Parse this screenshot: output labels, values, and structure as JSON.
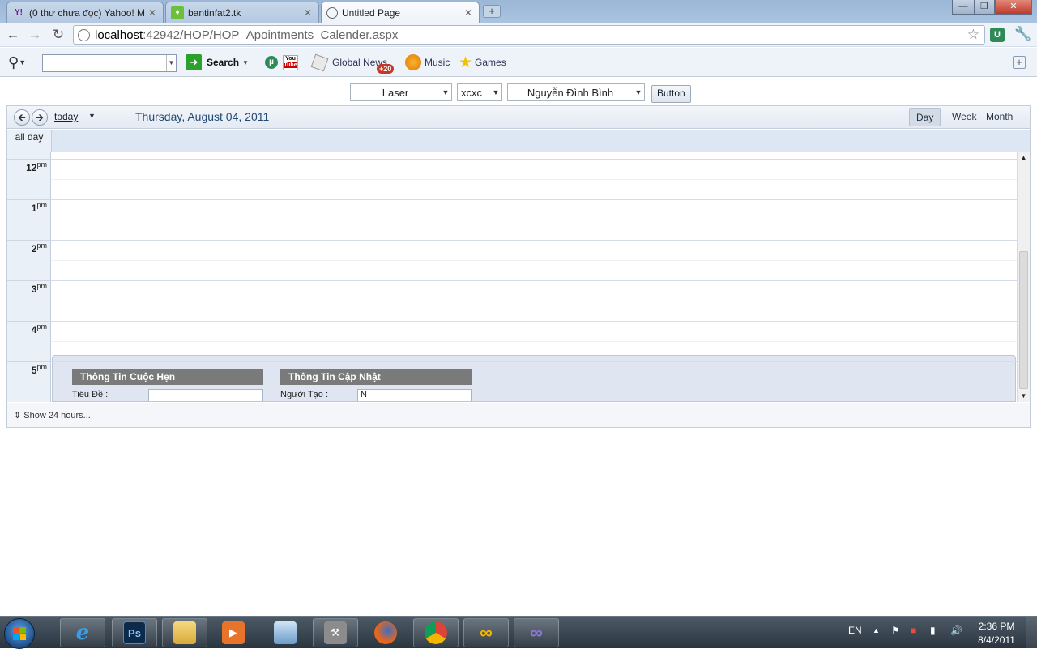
{
  "browser": {
    "tabs": [
      {
        "title": "(0 thư chưa đọc) Yahoo! M",
        "favicon": "yahoo-icon",
        "active": false
      },
      {
        "title": "bantinfat2.tk",
        "favicon": "green-site-icon",
        "active": false
      },
      {
        "title": "Untitled Page",
        "favicon": "globe-icon",
        "active": true
      }
    ],
    "url_host": "localhost",
    "url_path": ":42942/HOP/HOP_Apointments_Calender.aspx"
  },
  "ext_toolbar": {
    "search_label": "Search",
    "global_news_label": "Global News",
    "global_news_badge": "+20",
    "music_label": "Music",
    "games_label": "Games",
    "youtube_label_top": "You",
    "youtube_label_bottom": "Tube"
  },
  "filters": {
    "select1": "Laser",
    "select2": "xcxc",
    "select3": "Nguyễn Đình Bình",
    "button_label": "Button"
  },
  "scheduler": {
    "today_label": "today",
    "date_title": "Thursday, August 04, 2011",
    "views": [
      "Day",
      "Week",
      "Month"
    ],
    "selected_view": "Day",
    "allday_label": "all day",
    "hours": [
      {
        "hour": "12",
        "suffix": "pm"
      },
      {
        "hour": "1",
        "suffix": "pm"
      },
      {
        "hour": "2",
        "suffix": "pm"
      },
      {
        "hour": "3",
        "suffix": "pm"
      },
      {
        "hour": "4",
        "suffix": "pm"
      },
      {
        "hour": "5",
        "suffix": "pm"
      }
    ],
    "form": {
      "section1_title": "Thông Tin Cuộc Hẹn",
      "section1_field_label": "Tiêu Đề :",
      "section2_title": "Thông Tin Cập Nhật",
      "section2_field_label": "Người Tạo :",
      "section2_field_value": "N"
    },
    "footer_label": "Show 24 hours..."
  },
  "taskbar": {
    "language": "EN",
    "time": "2:36 PM",
    "date": "8/4/2011",
    "ps_label": "Ps"
  }
}
